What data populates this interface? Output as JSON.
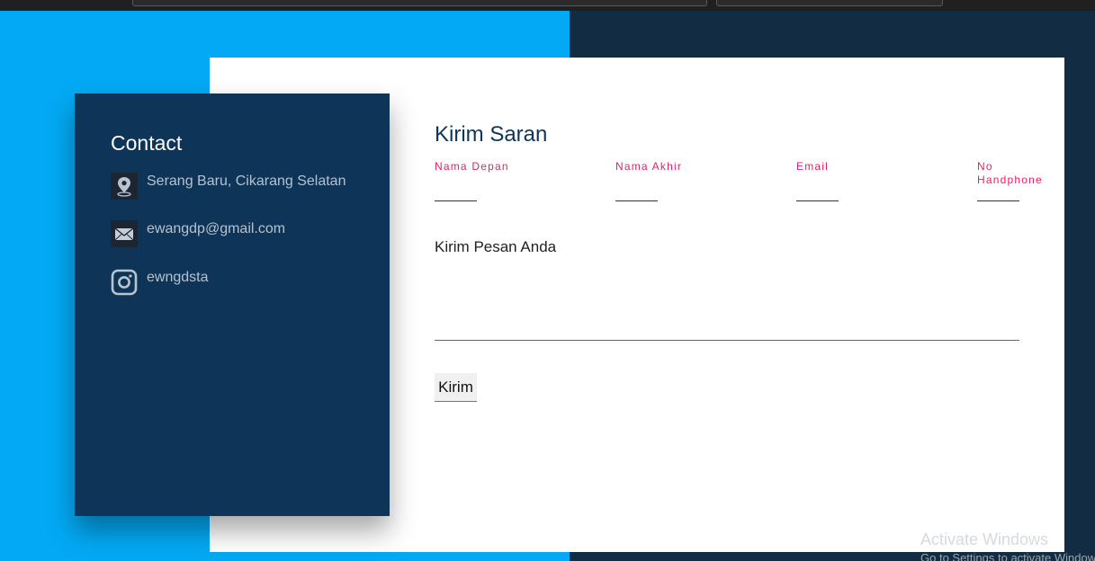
{
  "contact": {
    "title": "Contact",
    "items": [
      {
        "icon": "location-pin-icon",
        "text": "Serang Baru, Cikarang Selatan"
      },
      {
        "icon": "mail-icon",
        "text": "ewangdp@gmail.com"
      },
      {
        "icon": "instagram-icon",
        "text": "ewngdsta"
      }
    ]
  },
  "form": {
    "title": "Kirim Saran",
    "fields": [
      {
        "label": "Nama Depan",
        "value": ""
      },
      {
        "label": "Nama Akhir",
        "value": ""
      },
      {
        "label": "Email",
        "value": ""
      },
      {
        "label": "No Handphone",
        "value": ""
      }
    ],
    "message_label": "Kirim Pesan Anda",
    "message_value": "",
    "submit_label": "Kirim"
  },
  "watermark": {
    "line1": "Activate Windows",
    "line2": "Go to Settings to activate Windows."
  },
  "colors": {
    "left_background": "#03a9f4",
    "right_background": "#112c43",
    "contact_panel": "#0e3557",
    "field_label": "#e91e63",
    "form_title": "#0e3557"
  }
}
